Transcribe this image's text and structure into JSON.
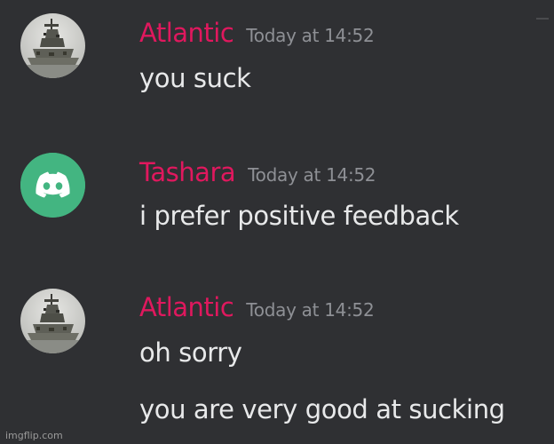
{
  "messages": [
    {
      "author": "Atlantic",
      "timestamp": "Today at 14:52",
      "avatar_icon": "ship-photo-avatar-icon",
      "lines": [
        "you suck"
      ]
    },
    {
      "author": "Tashara",
      "timestamp": "Today at 14:52",
      "avatar_icon": "discord-default-avatar-icon",
      "lines": [
        "i prefer positive feedback"
      ]
    },
    {
      "author": "Atlantic",
      "timestamp": "Today at 14:52",
      "avatar_icon": "ship-photo-avatar-icon",
      "lines": [
        "oh sorry",
        "you are very good at sucking"
      ]
    }
  ],
  "watermark": "imgflip.com",
  "colors": {
    "background": "#2f3033",
    "username": "#e0185e",
    "timestamp": "#8e9095",
    "message_text": "#e8e9ea",
    "discord_avatar": "#43b581"
  }
}
